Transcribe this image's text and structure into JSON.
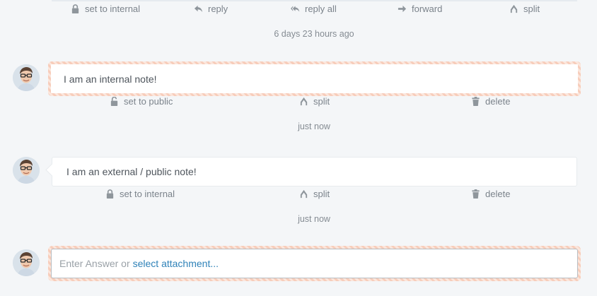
{
  "top_actions": {
    "set_internal": "set to internal",
    "reply": "reply",
    "reply_all": "reply all",
    "forward": "forward",
    "split": "split"
  },
  "top_timestamp": "6 days 23 hours ago",
  "internal_note": {
    "text": "I am an internal note!",
    "actions": {
      "set_public": "set to public",
      "split": "split",
      "delete": "delete"
    },
    "timestamp": "just now"
  },
  "public_note": {
    "text": "I am an external / public note!",
    "actions": {
      "set_internal": "set to internal",
      "split": "split",
      "delete": "delete"
    },
    "timestamp": "just now"
  },
  "answer": {
    "placeholder": "Enter Answer or",
    "attachment_link": "select attachment..."
  },
  "icons": [
    "lock-icon",
    "reply-icon",
    "reply-all-icon",
    "forward-icon",
    "split-icon",
    "trash-icon",
    "avatar"
  ],
  "colors": {
    "accent_link": "#2f82b8",
    "internal_stripe": "#f7cdbb",
    "background": "#f4f6f8"
  }
}
